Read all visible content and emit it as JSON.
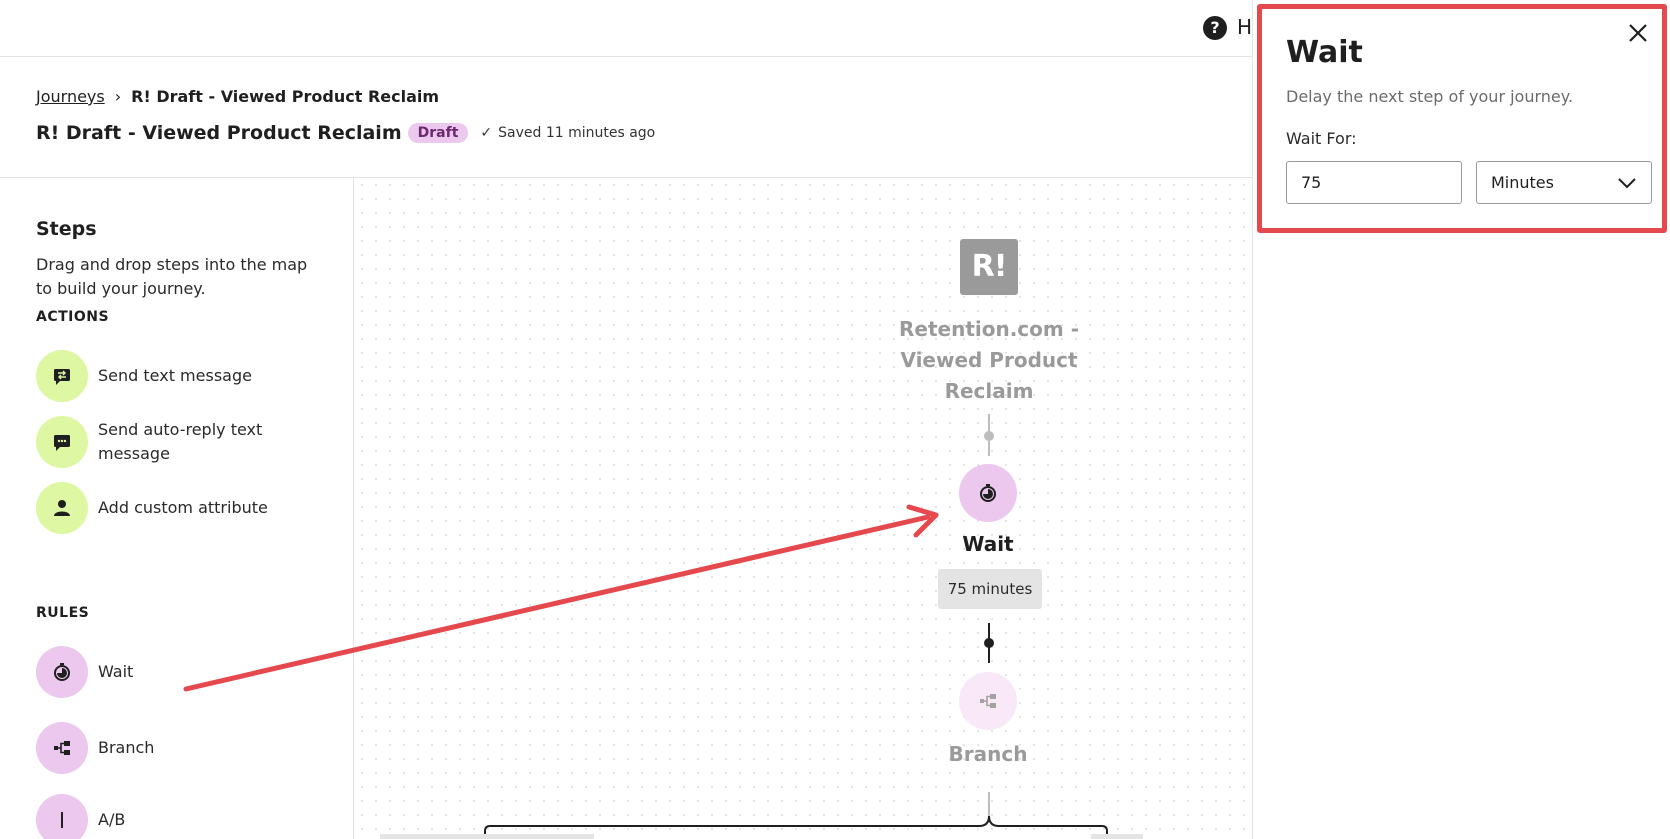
{
  "topbar": {
    "help_icon": "help-circle-icon",
    "help_icon_glyph": "?",
    "help_label": "H"
  },
  "breadcrumb": {
    "parent": "Journeys",
    "separator": "›",
    "current": "R! Draft - Viewed Product Reclaim"
  },
  "header": {
    "title": "R! Draft - Viewed Product Reclaim",
    "status_badge": "Draft",
    "saved_icon": "checkmark-icon",
    "saved_glyph": "✓",
    "saved_text": "Saved 11 minutes ago"
  },
  "sidebar": {
    "title": "Steps",
    "description": "Drag and drop steps into the map to build your journey.",
    "actions_label": "ACTIONS",
    "actions": [
      {
        "label": "Send text message",
        "icon": "message-send-icon"
      },
      {
        "label": "Send auto-reply text message",
        "icon": "chat-reply-icon"
      },
      {
        "label": "Add custom attribute",
        "icon": "person-icon"
      }
    ],
    "rules_label": "RULES",
    "rules": [
      {
        "label": "Wait",
        "icon": "stopwatch-icon"
      },
      {
        "label": "Branch",
        "icon": "branch-icon"
      },
      {
        "label": "A/B",
        "icon": "split-icon"
      }
    ]
  },
  "canvas": {
    "trigger_logo_text": "R!",
    "trigger_label": "Retention.com - Viewed Product Reclaim",
    "wait_node_label": "Wait",
    "wait_node_value": "75 minutes",
    "branch_node_label": "Branch"
  },
  "panel": {
    "title": "Wait",
    "description": "Delay the next step of your journey.",
    "field_label": "Wait For:",
    "wait_value": "75",
    "unit_selected": "Minutes",
    "close_icon": "close-icon",
    "dropdown_icon": "chevron-down-icon"
  },
  "colors": {
    "action_circle": "#def7a3",
    "rule_circle": "#ecc7ee",
    "annotation": "#e5484d",
    "badge_bg": "#ecc7ee"
  }
}
